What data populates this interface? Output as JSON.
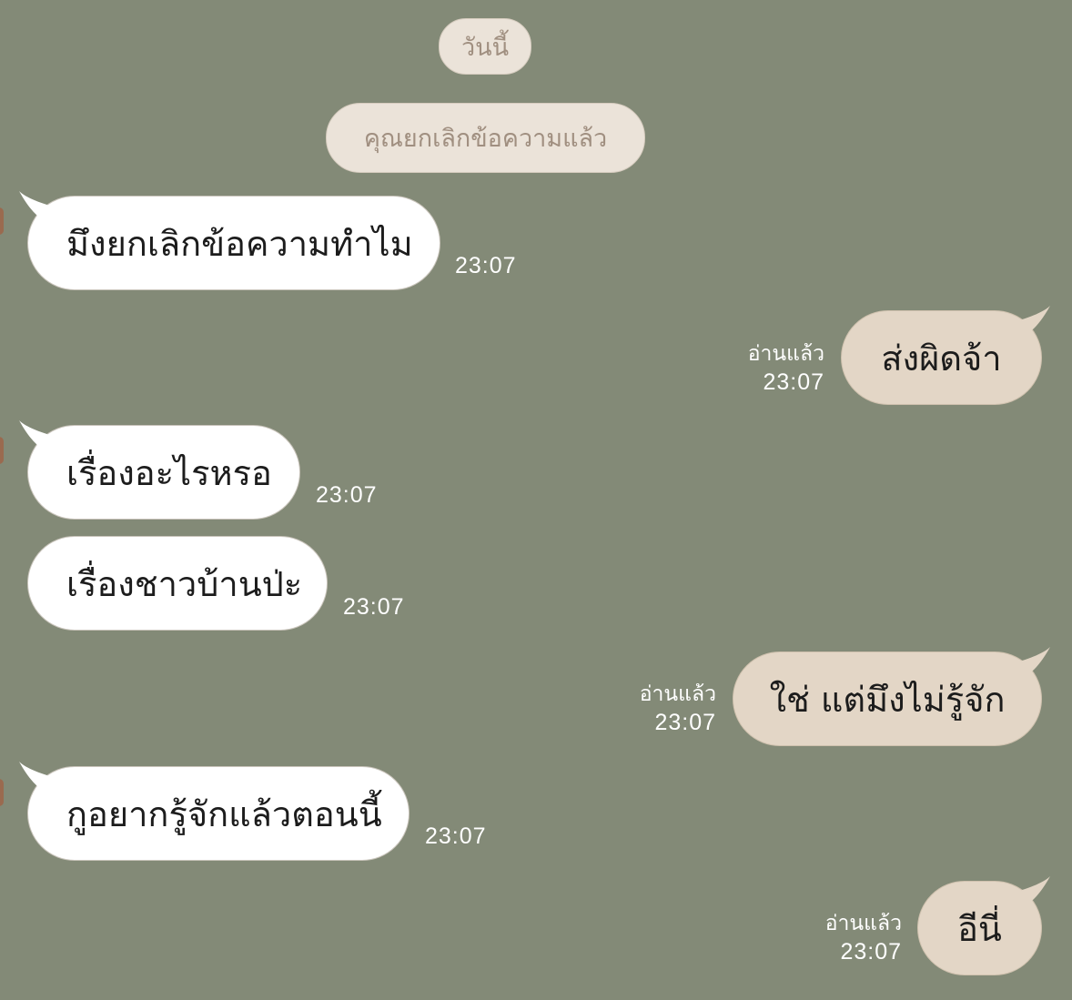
{
  "chat": {
    "date_label": "วันนี้",
    "system_notice": "คุณยกเลิกข้อความแล้ว",
    "read_label": "อ่านแล้ว",
    "messages": [
      {
        "side": "in",
        "text": "มึงยกเลิกข้อความทำไม",
        "time": "23:07"
      },
      {
        "side": "out",
        "text": "ส่งผิดจ้า",
        "time": "23:07",
        "read": "อ่านแล้ว"
      },
      {
        "side": "in",
        "text": "เรื่องอะไรหรอ",
        "time": "23:07"
      },
      {
        "side": "in",
        "text": "เรื่องชาวบ้านป่ะ",
        "time": "23:07"
      },
      {
        "side": "out",
        "text": "ใช่ แต่มึงไม่รู้จัก",
        "time": "23:07",
        "read": "อ่านแล้ว"
      },
      {
        "side": "in",
        "text": "กูอยากรู้จักแล้วตอนนี้",
        "time": "23:07"
      },
      {
        "side": "out",
        "text": "อีนี่",
        "time": "23:07",
        "read": "อ่านแล้ว"
      }
    ]
  },
  "colors": {
    "background": "#838a77",
    "incoming_bubble": "#ffffff",
    "outgoing_bubble": "#e3d6c6",
    "system_pill": "#ebe3d9"
  }
}
